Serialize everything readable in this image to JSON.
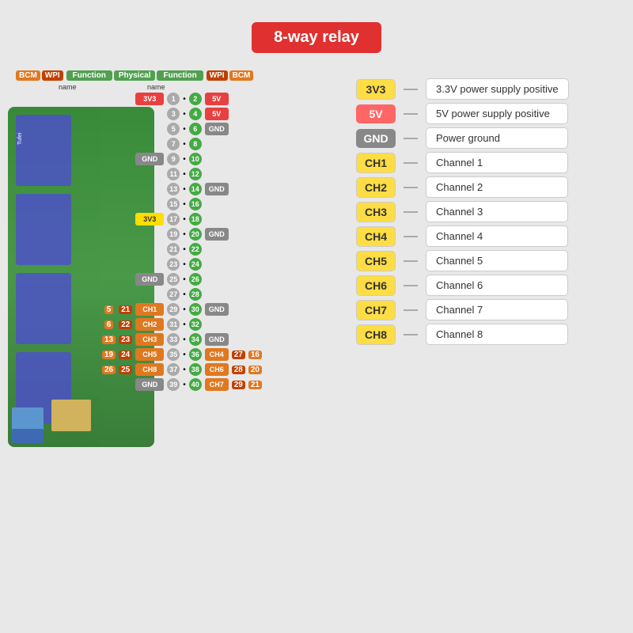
{
  "title": "8-way relay",
  "legend": {
    "items": [
      {
        "badge": "3V3",
        "badge_class": "badge-3v3",
        "desc": "3.3V power supply positive"
      },
      {
        "badge": "5V",
        "badge_class": "badge-5v",
        "desc": "5V power supply positive"
      },
      {
        "badge": "GND",
        "badge_class": "badge-gnd",
        "desc": "Power ground"
      },
      {
        "badge": "CH1",
        "badge_class": "badge-ch",
        "desc": "Channel 1"
      },
      {
        "badge": "CH2",
        "badge_class": "badge-ch",
        "desc": "Channel 2"
      },
      {
        "badge": "CH3",
        "badge_class": "badge-ch",
        "desc": "Channel 3"
      },
      {
        "badge": "CH4",
        "badge_class": "badge-ch",
        "desc": "Channel 4"
      },
      {
        "badge": "CH5",
        "badge_class": "badge-ch",
        "desc": "Channel 5"
      },
      {
        "badge": "CH6",
        "badge_class": "badge-ch",
        "desc": "Channel 6"
      },
      {
        "badge": "CH7",
        "badge_class": "badge-ch",
        "desc": "Channel 7"
      },
      {
        "badge": "CH8",
        "badge_class": "badge-ch",
        "desc": "Channel 8"
      }
    ]
  },
  "gpio": {
    "header": {
      "bcm": "BCM",
      "wpi": "WPI",
      "function_left": "Function",
      "physical": "Physical",
      "function_right": "Function",
      "wpi_right": "WPI",
      "bcm_right": "BCM"
    },
    "name_left": "name",
    "name_right": "name"
  }
}
